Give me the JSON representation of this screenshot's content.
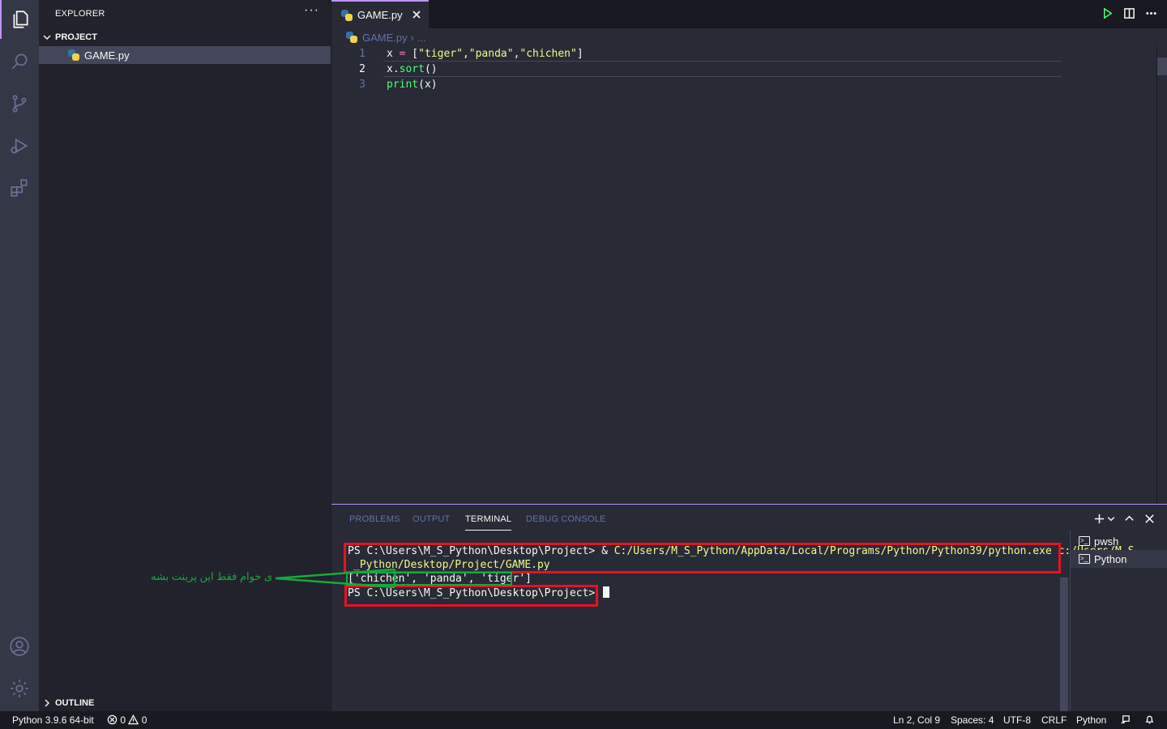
{
  "activity_bar": {
    "icons": [
      "files-icon",
      "search-icon",
      "source-control-icon",
      "run-debug-icon",
      "extensions-icon",
      "account-icon",
      "settings-gear-icon"
    ]
  },
  "sidebar": {
    "title": "EXPLORER",
    "more": "···",
    "project_section": "PROJECT",
    "file": "GAME.py",
    "outline_section": "OUTLINE"
  },
  "editor": {
    "tab_label": "GAME.py",
    "breadcrumb_file": "GAME.py",
    "breadcrumb_more": "...",
    "lines": [
      {
        "n": "1",
        "parts": [
          [
            "x ",
            "plain"
          ],
          [
            "=",
            "op"
          ],
          [
            " [",
            "plain"
          ],
          [
            "\"tiger\"",
            "str"
          ],
          [
            ",",
            "plain"
          ],
          [
            "\"panda\"",
            "str"
          ],
          [
            ",",
            "plain"
          ],
          [
            "\"chichen\"",
            "str"
          ],
          [
            "]",
            "plain"
          ]
        ]
      },
      {
        "n": "2",
        "parts": [
          [
            "x.",
            "plain"
          ],
          [
            "sort",
            "fn"
          ],
          [
            "()",
            "plain"
          ]
        ]
      },
      {
        "n": "3",
        "parts": [
          [
            "print",
            "fn"
          ],
          [
            "(x)",
            "plain"
          ]
        ]
      }
    ]
  },
  "panel": {
    "tabs": [
      "PROBLEMS",
      "OUTPUT",
      "TERMINAL",
      "DEBUG CONSOLE"
    ],
    "active_tab": "TERMINAL",
    "terminal": {
      "line1_prompt": "PS C:\\Users\\M_S_Python\\Desktop\\Project> & ",
      "line1_cmd": "C:/Users/M_S_Python/AppData/Local/Programs/Python/Python39/python.exe c:/Users/M_S",
      "line2_cmd": "_Python/Desktop/Project/GAME.py",
      "line3_output": "['chichen', 'panda', 'tiger']",
      "line4_prompt": "PS C:\\Users\\M_S_Python\\Desktop\\Project> "
    },
    "terminal_list": [
      "pwsh",
      "Python"
    ]
  },
  "annotation": {
    "text": "ی خوام فقط این پرینت بشه"
  },
  "statusbar": {
    "interpreter": "Python 3.9.6 64-bit",
    "errors": "0",
    "warnings": "0",
    "position": "Ln 2, Col 9",
    "spaces": "Spaces: 4",
    "encoding": "UTF-8",
    "eol": "CRLF",
    "language": "Python"
  }
}
